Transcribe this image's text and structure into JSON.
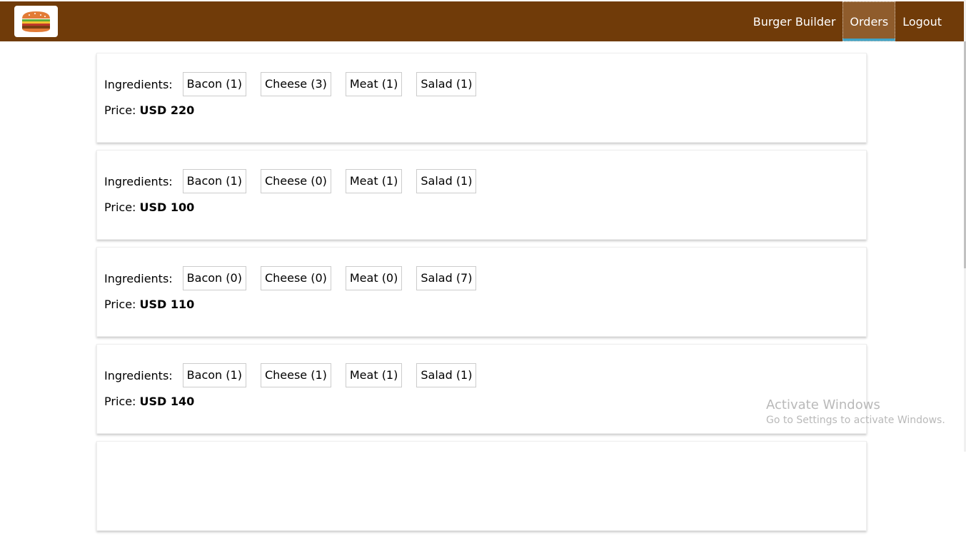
{
  "app": {
    "logo_icon": "burger-logo-icon",
    "nav": [
      {
        "label": "Burger Builder",
        "active": false
      },
      {
        "label": "Orders",
        "active": true
      },
      {
        "label": "Logout",
        "active": false
      }
    ]
  },
  "colors": {
    "toolbar": "#703b09",
    "active_nav": "#8f5c2c",
    "active_underline": "#40a4c8"
  },
  "orders": [
    {
      "ingredients_label": "Ingredients:",
      "ingredients": [
        "Bacon (1)",
        "Cheese (3)",
        "Meat (1)",
        "Salad (1)"
      ],
      "price_label": "Price:",
      "price": "USD 220"
    },
    {
      "ingredients_label": "Ingredients:",
      "ingredients": [
        "Bacon (1)",
        "Cheese (0)",
        "Meat (1)",
        "Salad (1)"
      ],
      "price_label": "Price:",
      "price": "USD 100"
    },
    {
      "ingredients_label": "Ingredients:",
      "ingredients": [
        "Bacon (0)",
        "Cheese (0)",
        "Meat (0)",
        "Salad (7)"
      ],
      "price_label": "Price:",
      "price": "USD 110"
    },
    {
      "ingredients_label": "Ingredients:",
      "ingredients": [
        "Bacon (1)",
        "Cheese (1)",
        "Meat (1)",
        "Salad (1)"
      ],
      "price_label": "Price:",
      "price": "USD 140"
    },
    {
      "ingredients_label": "",
      "ingredients": [],
      "price_label": "",
      "price": ""
    }
  ],
  "watermark": {
    "title": "Activate Windows",
    "subtitle": "Go to Settings to activate Windows."
  }
}
